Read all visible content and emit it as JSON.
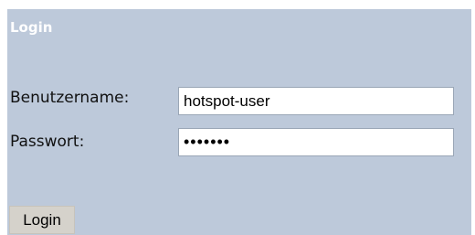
{
  "login": {
    "title": "Login",
    "username_label": "Benutzername:",
    "username_value": "hotspot-user",
    "password_label": "Passwort:",
    "password_value": "hotspot",
    "submit_label": "Login"
  },
  "colors": {
    "panel_background": "#bdc9da",
    "title_text": "#ffffff",
    "button_background": "#d5d2cb"
  }
}
